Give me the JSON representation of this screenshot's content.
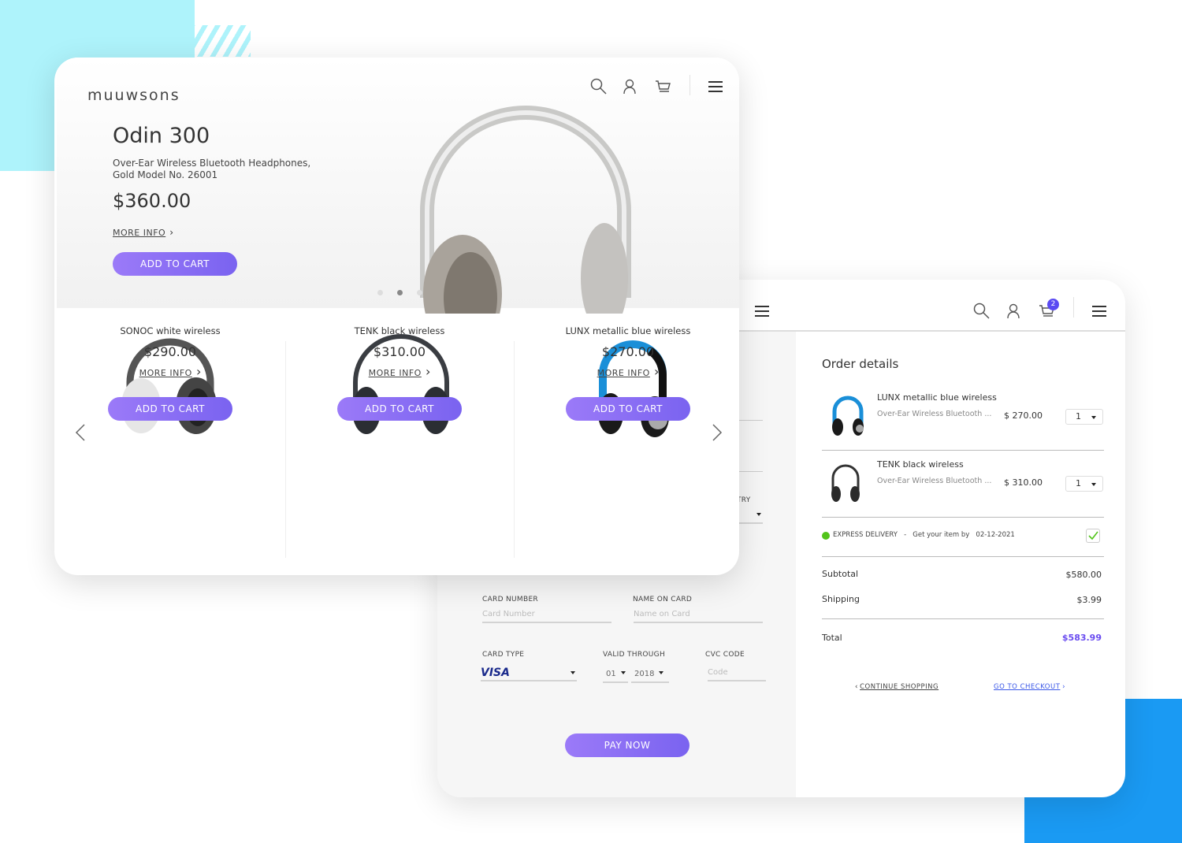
{
  "brand": "muuwsons",
  "colors": {
    "accent": "#8b6ff6",
    "total": "#6a4cf0",
    "cyan": "#aef3fb",
    "blue": "#1a9af3",
    "delivery": "#52c41a"
  },
  "hero": {
    "title": "Odin 300",
    "subtitle_line1": "Over-Ear Wireless Bluetooth Headphones,",
    "subtitle_line2": "Gold Model No. 26001",
    "price": "$360.00",
    "more_info": "MORE INFO",
    "add_to_cart": "ADD TO CART",
    "carousel_active_index": 1,
    "carousel_count": 3
  },
  "products": [
    {
      "name": "SONOC white wireless",
      "price": "$290.00",
      "more_info": "MORE INFO",
      "add_to_cart": "ADD TO CART"
    },
    {
      "name": "TENK black wireless",
      "price": "$310.00",
      "more_info": "MORE INFO",
      "add_to_cart": "ADD TO CART"
    },
    {
      "name": "LUNX metallic blue wireless",
      "price": "$270.00",
      "more_info": "MORE INFO",
      "add_to_cart": "ADD TO CART"
    }
  ],
  "checkout": {
    "cart_count": "2",
    "country_label_partial": "TRY",
    "card_number_label": "CARD NUMBER",
    "card_number_placeholder": "Card Number",
    "name_label": "NAME ON CARD",
    "name_placeholder": "Name on Card",
    "card_type_label": "CARD TYPE",
    "card_type_value": "VISA",
    "valid_label": "VALID THROUGH",
    "month": "01",
    "year": "2018",
    "cvc_label": "CVC CODE",
    "cvc_placeholder": "Code",
    "pay_now": "PAY NOW"
  },
  "order": {
    "title": "Order details",
    "items": [
      {
        "name": "LUNX metallic blue wireless",
        "desc": "Over-Ear Wireless Bluetooth ...",
        "price": "$ 270.00",
        "qty": "1"
      },
      {
        "name": "TENK black wireless",
        "desc": "Over-Ear Wireless Bluetooth ...",
        "price": "$ 310.00",
        "qty": "1"
      }
    ],
    "delivery_label": "EXPRESS DELIVERY",
    "delivery_sep": "-",
    "delivery_text": "Get your item by",
    "delivery_date": "02-12-2021",
    "delivery_checked": true,
    "subtotal_label": "Subtotal",
    "subtotal": "$580.00",
    "shipping_label": "Shipping",
    "shipping": "$3.99",
    "total_label": "Total",
    "total": "$583.99",
    "continue": "CONTINUE SHOPPING",
    "checkout": "GO TO CHECKOUT"
  }
}
